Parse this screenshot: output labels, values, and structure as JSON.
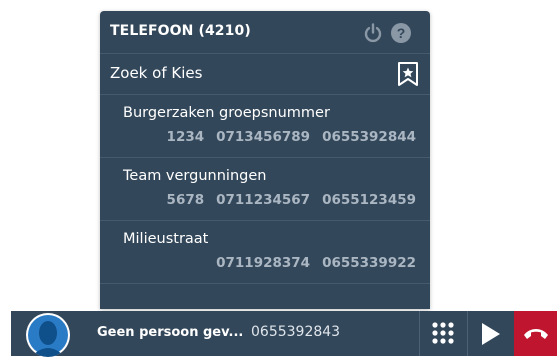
{
  "panel": {
    "title": "TELEFOON (4210)",
    "icons": {
      "power": "power-icon",
      "help": "help-icon",
      "bookmark": "bookmark-star-icon"
    },
    "search_label": "Zoek of Kies"
  },
  "entries": [
    {
      "name": "Burgerzaken groepsnummer",
      "numbers": [
        "1234",
        "0713456789",
        "0655392844"
      ]
    },
    {
      "name": "Team vergunningen",
      "numbers": [
        "5678",
        "0711234567",
        "0655123459"
      ]
    },
    {
      "name": "Milieustraat",
      "numbers": [
        "0711928374",
        "0655339922"
      ]
    }
  ],
  "callbar": {
    "caller_name": "Geen persoon gev...",
    "caller_number": "0655392843",
    "icons": {
      "avatar": "person-avatar",
      "keypad": "keypad-icon",
      "play": "play-icon",
      "hangup": "hang-up-phone-icon"
    },
    "colors": {
      "bar": "#33475a",
      "hangup": "#c0152e"
    }
  }
}
